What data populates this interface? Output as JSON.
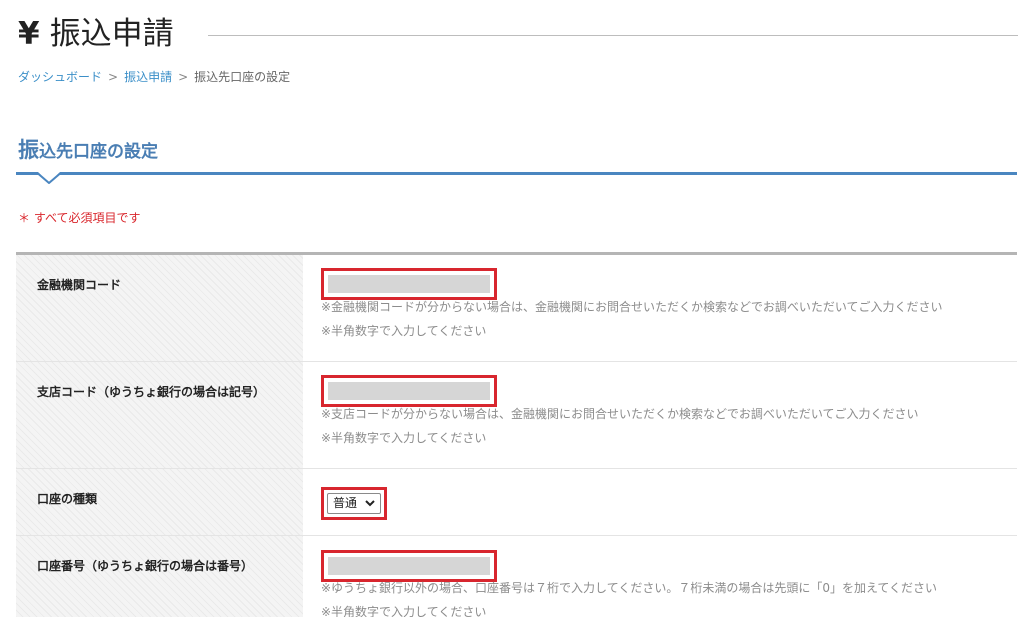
{
  "header": {
    "currency_symbol": "¥",
    "title": "振込申請"
  },
  "breadcrumb": {
    "items": [
      "ダッシュボード",
      "振込申請",
      "振込先口座の設定"
    ],
    "separator": ">"
  },
  "section": {
    "title_first_char": "振",
    "title_rest": "込先口座の設定"
  },
  "required_note": "＊ すべて必須項目です",
  "form": {
    "bank_code": {
      "label": "金融機関コード",
      "value": "",
      "hint1": "※金融機関コードが分からない場合は、金融機関にお問合せいただくか検索などでお調べいただいてご入力ください",
      "hint2": "※半角数字で入力してください"
    },
    "branch_code": {
      "label": "支店コード（ゆうちょ銀行の場合は記号）",
      "value": "",
      "hint1": "※支店コードが分からない場合は、金融機関にお問合せいただくか検索などでお調べいただいてご入力ください",
      "hint2": "※半角数字で入力してください"
    },
    "account_type": {
      "label": "口座の種類",
      "selected": "普通"
    },
    "account_number": {
      "label": "口座番号（ゆうちょ銀行の場合は番号）",
      "value": "",
      "hint1": "※ゆうちょ銀行以外の場合、口座番号は７桁で入力してください。７桁未満の場合は先頭に「0」を加えてください",
      "hint2": "※半角数字で入力してください"
    }
  },
  "colors": {
    "accent_blue": "#4a86c0",
    "link_blue": "#3b8fc8",
    "highlight_red": "#d8262e",
    "required_red": "#d9262c"
  },
  "icons": {
    "select_chevron": "chevron-down-icon"
  }
}
